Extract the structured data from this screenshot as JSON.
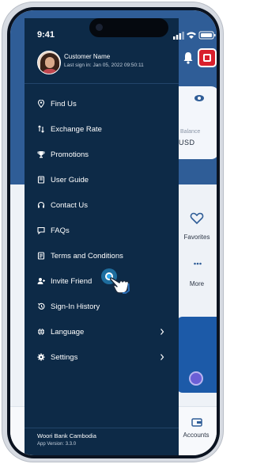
{
  "status_bar": {
    "time": "9:41"
  },
  "background": {
    "balance_label": "...able Balance",
    "balance_value": "*** USD",
    "favorites_label": "Favorites",
    "more_label": "More",
    "accounts_label": "Accounts"
  },
  "drawer": {
    "profile": {
      "name": "Customer Name",
      "last_sign_in": "Last sign in: Jan 05, 2022 09:50:11"
    },
    "items": [
      {
        "label": "Find Us",
        "icon": "location-pin-icon",
        "chevron": false
      },
      {
        "label": "Exchange Rate",
        "icon": "exchange-icon",
        "chevron": false
      },
      {
        "label": "Promotions",
        "icon": "trophy-icon",
        "chevron": false
      },
      {
        "label": "User Guide",
        "icon": "book-icon",
        "chevron": false
      },
      {
        "label": "Contact Us",
        "icon": "headset-icon",
        "chevron": false
      },
      {
        "label": "FAQs",
        "icon": "chat-question-icon",
        "chevron": false
      },
      {
        "label": "Terms and Conditions",
        "icon": "document-icon",
        "chevron": false
      },
      {
        "label": "Invite Friend",
        "icon": "add-user-icon",
        "chevron": false
      },
      {
        "label": "Sign-In History",
        "icon": "history-icon",
        "chevron": false
      },
      {
        "label": "Language",
        "icon": "globe-icon",
        "chevron": true
      },
      {
        "label": "Settings",
        "icon": "gear-icon",
        "chevron": true
      }
    ],
    "footer": {
      "bank_name": "Woori Bank Cambodia",
      "app_version": "App Version: 3.3.0"
    }
  },
  "colors": {
    "drawer_bg": "#0d2a47",
    "brand_blue": "#2f5d97",
    "accent_red": "#d81f2c",
    "tap_highlight": "#2fa8ec"
  }
}
